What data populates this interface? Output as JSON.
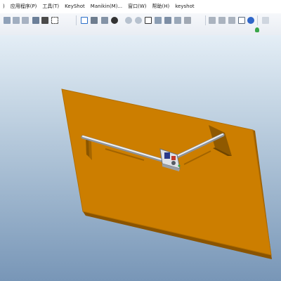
{
  "menu": {
    "items": [
      {
        "id": "window-edge",
        "label": ")"
      },
      {
        "id": "applications",
        "label": "应用程序(P)"
      },
      {
        "id": "tools",
        "label": "工具(T)"
      },
      {
        "id": "keyshot",
        "label": "KeyShot"
      },
      {
        "id": "manikin",
        "label": "Manikin(M)..."
      },
      {
        "id": "window",
        "label": "窗口(W)"
      },
      {
        "id": "help",
        "label": "帮助(H)"
      },
      {
        "id": "keyshot-lower",
        "label": "keyshot"
      }
    ]
  },
  "toolbar": {
    "row1_icons": [
      "copy-icon",
      "paste-icon",
      "paste-special-icon",
      "regenerate-icon",
      "find-icon",
      "select-box-icon",
      "repaint-icon",
      "view-manager-icon",
      "shading-icon",
      "spin-center-icon",
      "zoom-in-icon",
      "zoom-out-icon",
      "refit-icon",
      "reorient-icon",
      "saved-views-icon",
      "layers-icon",
      "plane-display-icon",
      "axis-display-icon",
      "point-display-icon",
      "csys-display-icon",
      "annotation-display-icon",
      "appearance-icon",
      "sketch-icon"
    ],
    "row2_icons": [
      "status-icon"
    ]
  },
  "colors": {
    "plate": "#cc7e00",
    "plate_dark": "#7a4a00",
    "rod": "#d9dde2",
    "accent_green": "#3aa64a"
  }
}
